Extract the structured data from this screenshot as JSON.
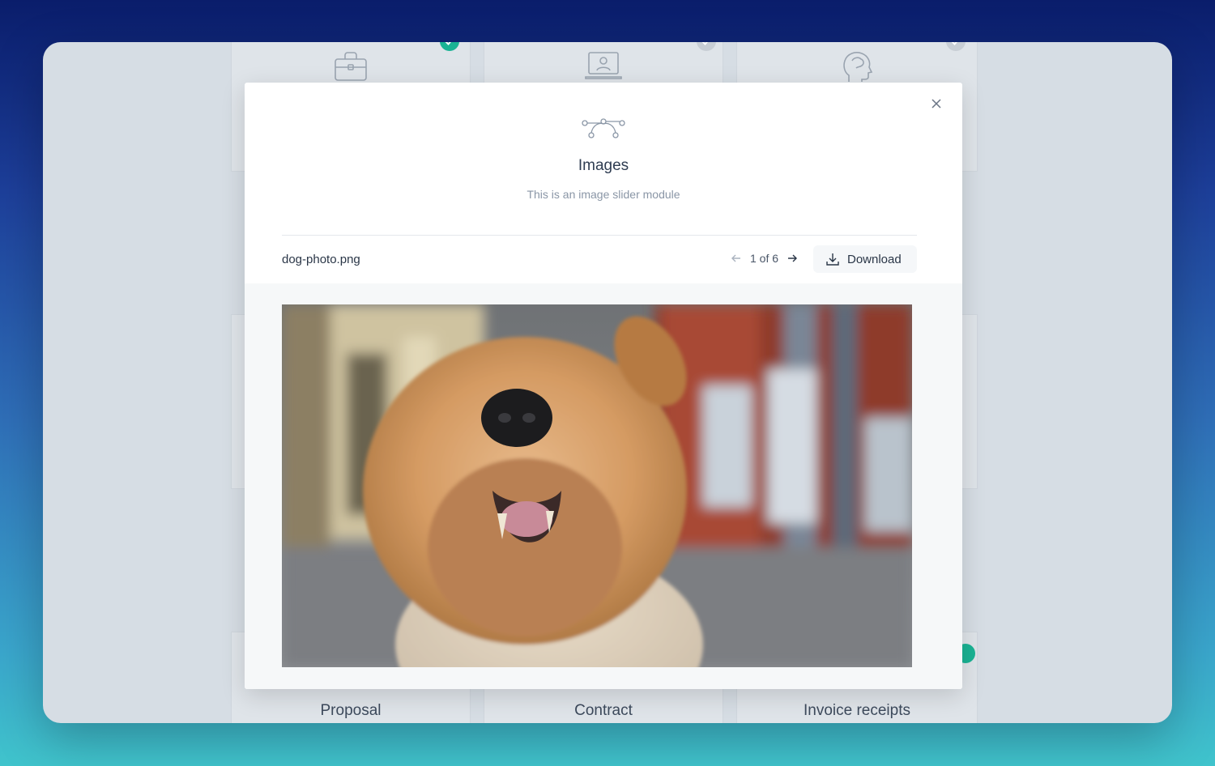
{
  "background_cards": {
    "labels": [
      "Proposal",
      "Contract",
      "Invoice receipts"
    ],
    "icons": [
      "briefcase-icon",
      "laptop-user-icon",
      "head-brain-icon"
    ]
  },
  "modal": {
    "icon": "vector-bezier-icon",
    "title": "Images",
    "subtitle": "This is an image slider module",
    "close_icon": "close-icon",
    "file_name": "dog-photo.png",
    "pager": {
      "current": 1,
      "total": 6,
      "text": "1 of 6"
    },
    "download_label": "Download",
    "image_alt": "dog-photo"
  },
  "colors": {
    "accent_green": "#1ab394",
    "text_dark": "#2a3647",
    "text_muted": "#8a96a6"
  }
}
